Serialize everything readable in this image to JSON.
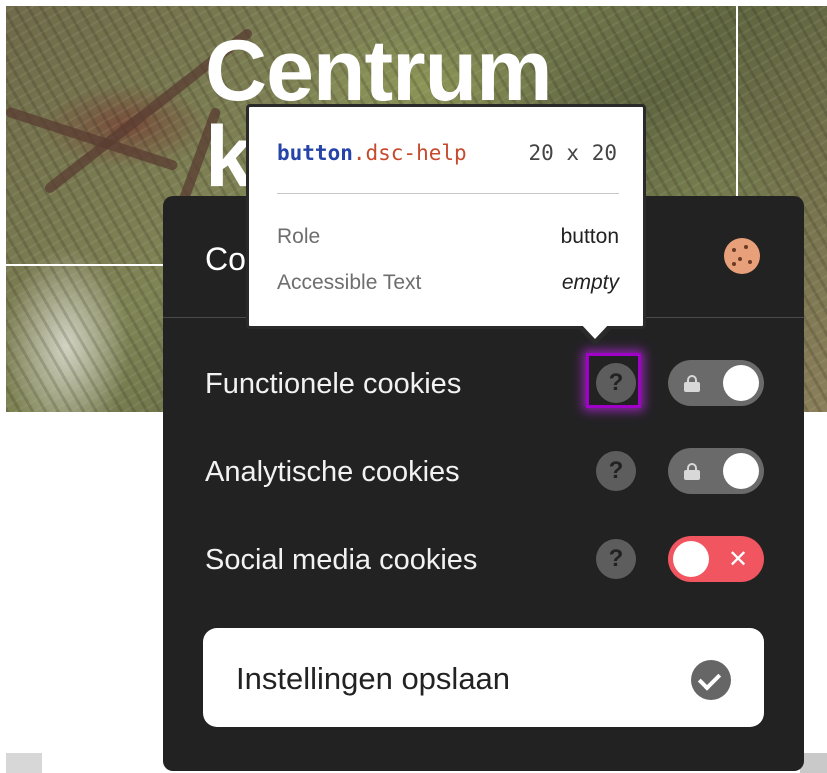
{
  "hero": {
    "title_line1": "Centrum",
    "title_line2": "k          t"
  },
  "dialog": {
    "title_partial": "Co",
    "cookie_icon": "cookie-icon",
    "rows": [
      {
        "label": "Functionele cookies",
        "help": "?",
        "toggle": "locked-on"
      },
      {
        "label": "Analytische cookies",
        "help": "?",
        "toggle": "locked-on"
      },
      {
        "label": "Social media cookies",
        "help": "?",
        "toggle": "off",
        "toggle_symbol": "✕"
      }
    ],
    "save_button": {
      "label": "Instellingen opslaan",
      "icon": "check-circle-icon"
    }
  },
  "devtools_tooltip": {
    "tag": "button",
    "class": ".dsc-help",
    "size": "20 x 20",
    "role_label": "Role",
    "role_value": "button",
    "accessible_text_label": "Accessible Text",
    "accessible_text_value": "empty"
  },
  "colors": {
    "dialog_bg": "#222223",
    "toggle_off": "#f05560",
    "highlight": "#a000c8"
  }
}
